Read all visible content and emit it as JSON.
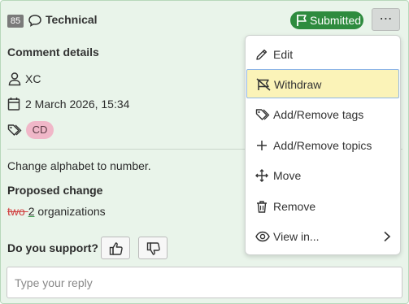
{
  "header": {
    "number": "85",
    "category": "Technical",
    "status": "Submitted",
    "menu_label": "⋯"
  },
  "details": {
    "title": "Comment details",
    "user": "XC",
    "date": "2 March 2026, 15:34",
    "tag": "CD"
  },
  "comment": {
    "text": "Change alphabet to number.",
    "proposed_title": "Proposed change",
    "deleted": "two ",
    "inserted": "2",
    "rest": " organizations"
  },
  "support": {
    "label": "Do you support?"
  },
  "reply": {
    "placeholder": "Type your reply"
  },
  "menu": {
    "items": [
      {
        "label": "Edit",
        "icon": "pencil-icon"
      },
      {
        "label": "Withdraw",
        "icon": "flag-off-icon"
      },
      {
        "label": "Add/Remove tags",
        "icon": "tag-icon"
      },
      {
        "label": "Add/Remove topics",
        "icon": "plus-icon"
      },
      {
        "label": "Move",
        "icon": "move-icon"
      },
      {
        "label": "Remove",
        "icon": "trash-icon"
      },
      {
        "label": "View in...",
        "icon": "eye-icon"
      }
    ]
  },
  "colors": {
    "card_bg": "#e9f4ea",
    "status_green": "#2e8b3e",
    "tag_pink": "#f0b7c8",
    "highlight": "#fbf3b8"
  }
}
